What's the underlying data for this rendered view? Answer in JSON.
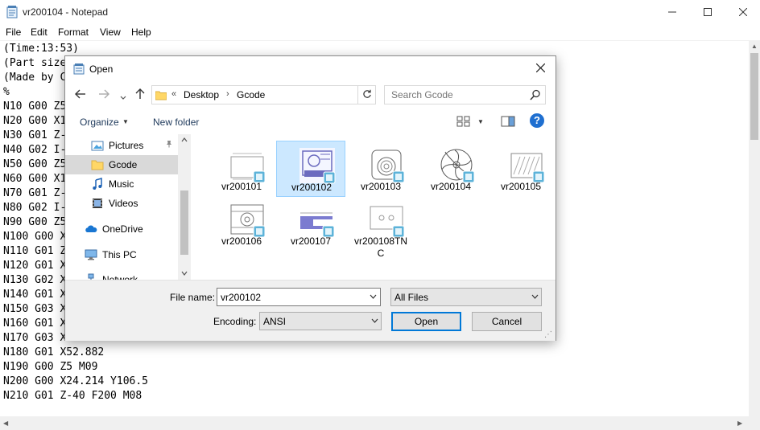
{
  "notepad": {
    "title": "vr200104 - Notepad",
    "menu": [
      "File",
      "Edit",
      "Format",
      "View",
      "Help"
    ],
    "lines": [
      "(Time:13:53)",
      "(Part size",
      "(Made by C",
      "%",
      "N10 G00 Z5",
      "N20 G00 X1",
      "N30 G01 Z-",
      "N40 G02 I-",
      "N50 G00 Z5",
      "N60 G00 X1",
      "N70 G01 Z-",
      "N80 G02 I-",
      "N90 G00 Z5",
      "N100 G00 X",
      "N110 G01 Z",
      "N120 G01 X",
      "N130 G02 X",
      "N140 G01 X",
      "N150 G03 X",
      "N160 G01 X",
      "N170 G03 X",
      "N180 G01 X52.882",
      "N190 G00 Z5 M09",
      "N200 G00 X24.214 Y106.5",
      "N210 G01 Z-40 F200 M08"
    ]
  },
  "dialog": {
    "title": "Open",
    "address": {
      "overflow": "«",
      "parts": [
        "Desktop",
        "Gcode"
      ]
    },
    "search_placeholder": "Search Gcode",
    "toolbar": {
      "organize": "Organize",
      "new_folder": "New folder"
    },
    "nav_items": [
      {
        "label": "Pictures",
        "icon": "pictures-icon",
        "pinned": true,
        "selected": false
      },
      {
        "label": "Gcode",
        "icon": "folder-icon",
        "pinned": false,
        "selected": true
      },
      {
        "label": "Music",
        "icon": "music-icon",
        "pinned": false,
        "selected": false
      },
      {
        "label": "Videos",
        "icon": "videos-icon",
        "pinned": false,
        "selected": false
      },
      {
        "label": "OneDrive",
        "icon": "onedrive-icon",
        "pinned": false,
        "selected": false
      },
      {
        "label": "This PC",
        "icon": "this-pc-icon",
        "pinned": false,
        "selected": false
      },
      {
        "label": "Network",
        "icon": "network-icon",
        "pinned": false,
        "selected": false
      }
    ],
    "files": [
      {
        "name": "vr200101",
        "selected": false
      },
      {
        "name": "vr200102",
        "selected": true
      },
      {
        "name": "vr200103",
        "selected": false
      },
      {
        "name": "vr200104",
        "selected": false
      },
      {
        "name": "vr200105",
        "selected": false
      },
      {
        "name": "vr200106",
        "selected": false
      },
      {
        "name": "vr200107",
        "selected": false
      },
      {
        "name": "vr200108TNC",
        "selected": false
      }
    ],
    "file_name_label": "File name:",
    "file_name_value": "vr200102",
    "file_type": "All Files",
    "encoding_label": "Encoding:",
    "encoding_value": "ANSI",
    "open_label": "Open",
    "cancel_label": "Cancel"
  },
  "colors": {
    "selection": "#cce8ff",
    "selection_border": "#99d1ff",
    "accent": "#0078d7",
    "folder": "#ffd766"
  }
}
